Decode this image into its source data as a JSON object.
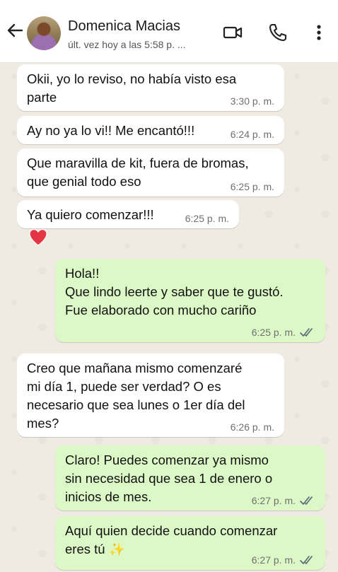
{
  "header": {
    "contact_name": "Domenica Macias",
    "status": "últ. vez hoy a las 5:58 p. ...",
    "icons": [
      "back-arrow-icon",
      "video-call-icon",
      "voice-call-icon",
      "more-options-icon"
    ]
  },
  "messages": [
    {
      "direction": "in",
      "text": "Okii, yo lo reviso, no había visto esa\nparte",
      "time": "3:30 p. m."
    },
    {
      "direction": "in",
      "text": "Ay no ya lo vi!! Me encantó!!!",
      "time": "6:24 p. m."
    },
    {
      "direction": "in",
      "text": "Que maravilla de kit, fuera de bromas,\nque genial todo eso",
      "time": "6:25 p. m."
    },
    {
      "direction": "in",
      "text": "Ya quiero comenzar!!!",
      "time": "6:25 p. m.",
      "reaction": "heart-emoji"
    },
    {
      "direction": "out",
      "text": "Hola!!\nQue lindo leerte y saber que te gustó.\nFue elaborado con mucho cariño",
      "time": "6:25 p. m.",
      "status": "read"
    },
    {
      "direction": "in",
      "text": "Creo que mañana mismo comenzaré\nmi día 1, puede ser verdad? O es\nnecesario que sea lunes o 1er día del\nmes?",
      "time": "6:26 p. m."
    },
    {
      "direction": "out",
      "text": "Claro! Puedes comenzar ya mismo\nsin necesidad que sea 1 de enero o\ninicios de mes.",
      "time": "6:27 p. m.",
      "status": "read"
    },
    {
      "direction": "out",
      "text": "Aquí quien decide cuando comenzar\neres tú ✨",
      "time": "6:27 p. m.",
      "status": "read"
    }
  ],
  "colors": {
    "incoming_bubble": "#ffffff",
    "outgoing_bubble": "#DCF8C6",
    "read_ticks": "#5b6b75",
    "chat_background": "#EFEAE2"
  }
}
